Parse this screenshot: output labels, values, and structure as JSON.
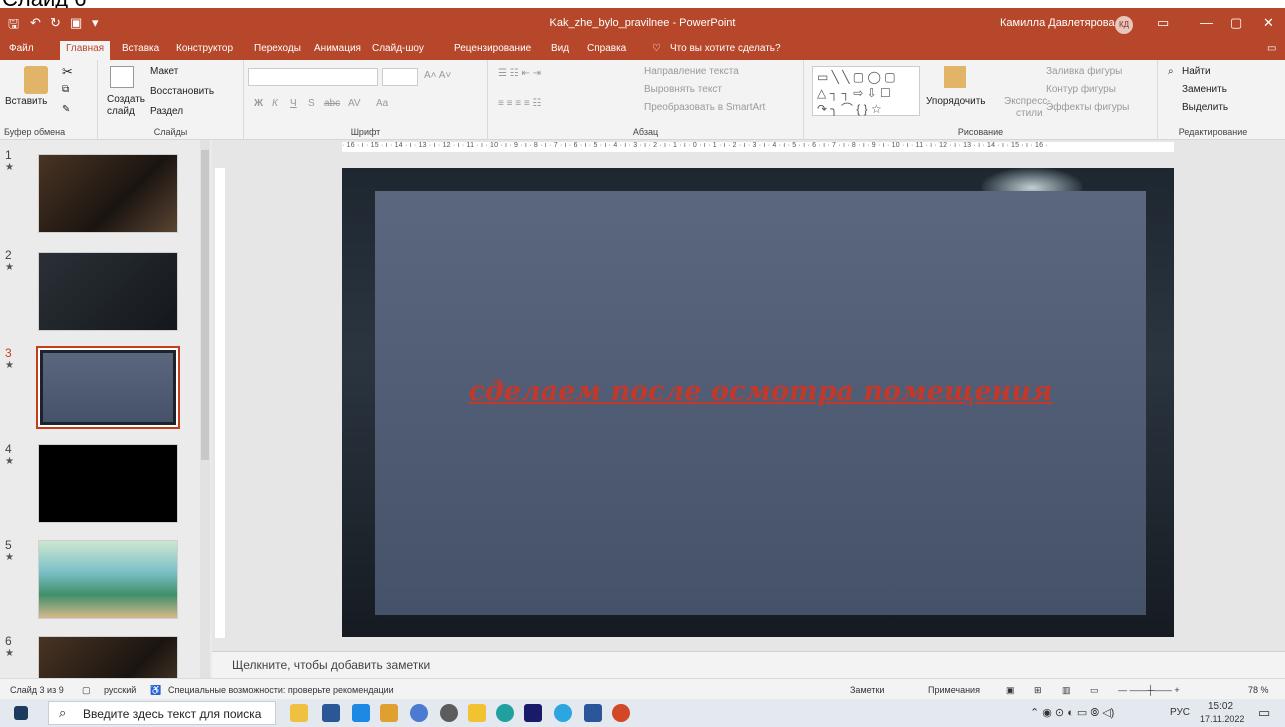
{
  "caption": "Слайд 6",
  "titlebar": {
    "title": "Kak_zhe_bylo_pravilnee  -  PowerPoint",
    "user": "Камилла Давлетярова",
    "avatar": "КД"
  },
  "menu": [
    "Файл",
    "Главная",
    "Вставка",
    "Конструктор",
    "Переходы",
    "Анимация",
    "Слайд-шоу",
    "Рецензирование",
    "Вид",
    "Справка",
    "Что вы хотите сделать?"
  ],
  "ribbon": {
    "clipboard": {
      "paste": "Вставить",
      "label": "Буфер обмена"
    },
    "slides": {
      "create": "Создать",
      "create2": "слайд",
      "layout": "Макет",
      "reset": "Восстановить",
      "section": "Раздел",
      "label": "Слайды"
    },
    "font": {
      "label": "Шрифт",
      "bold": "Ж",
      "italic": "К",
      "underline": "Ч",
      "shadow": "S",
      "strike": "abc",
      "spacing": "AV",
      "case": "Aa"
    },
    "paragraph": {
      "label": "Абзац",
      "dir": "Направление текста",
      "align": "Выровнять текст",
      "smartart": "Преобразовать в SmartArt"
    },
    "drawing": {
      "label": "Рисование",
      "arrange": "Упорядочить",
      "styles": "Экспресс-",
      "styles2": "стили",
      "fill": "Заливка фигуры",
      "outline": "Контур фигуры",
      "effects": "Эффекты фигуры"
    },
    "editing": {
      "label": "Редактирование",
      "find": "Найти",
      "replace": "Заменить",
      "select": "Выделить"
    }
  },
  "ruler": "· 16 · ı · 15 · ı · 14 · ı · 13 · ı · 12 · ı · 11 · ı · 10 · ı · 9 · ı · 8 · ı · 7 · ı · 6 · ı · 5 · ı · 4 · ı · 3 · ı · 2 · ı · 1 · ı · 0 · ı · 1 · ı · 2 · ı · 3 · ı · 4 · ı · 5 · ı · 6 · ı · 7 · ı · 8 · ı · 9 · ı · 10 · ı · 11 · ı · 12 · ı · 13 · ı · 14 · ı · 15 · ı · 16 ·",
  "slides": [
    "1",
    "2",
    "3",
    "4",
    "5",
    "6"
  ],
  "slide_text": "сделаем после осмотра помещения",
  "notes_placeholder": "Щелкните, чтобы добавить заметки",
  "status": {
    "slide": "Слайд 3 из 9",
    "lang": "русский",
    "access": "Специальные возможности: проверьте рекомендации",
    "notes": "Заметки",
    "comments": "Примечания",
    "zoom": "78 %"
  },
  "taskbar": {
    "search": "Введите здесь текст для поиска",
    "lang": "РУС",
    "time": "15:02",
    "date": "17.11.2022"
  }
}
